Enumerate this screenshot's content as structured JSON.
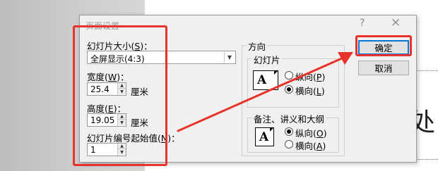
{
  "dialog": {
    "title": "页面设置",
    "help_glyph": "?",
    "close_glyph": "×"
  },
  "slide_size": {
    "label": "幻灯片大小(",
    "label_key": "S",
    "label_tail": ")：",
    "value": "全屏显示(4:3)"
  },
  "width": {
    "label": "宽度(",
    "label_key": "W",
    "label_tail": ")：",
    "value": "25.4",
    "unit": "厘米"
  },
  "height": {
    "label": "高度(",
    "label_key": "E",
    "label_tail": ")：",
    "value": "19.05",
    "unit": "厘米"
  },
  "start_number": {
    "label": "幻灯片编号起始值(",
    "label_key": "N",
    "label_tail": ")：",
    "value": "1"
  },
  "orientation": {
    "title": "方向",
    "slides": {
      "title": "幻灯片",
      "portrait": "纵向(",
      "portrait_key": "P",
      "landscape": "横向(",
      "landscape_key": "L",
      "selected": "landscape"
    },
    "notes": {
      "title": "备注、讲义和大纲",
      "portrait": "纵向(",
      "portrait_key": "O",
      "landscape": "横向(",
      "landscape_key": "A",
      "selected": "portrait"
    },
    "close_paren": ")"
  },
  "buttons": {
    "ok": "确定",
    "cancel": "取消"
  },
  "slide_text": "处",
  "annotation_color": "#e8332a",
  "default_button_color": "#0078d7"
}
